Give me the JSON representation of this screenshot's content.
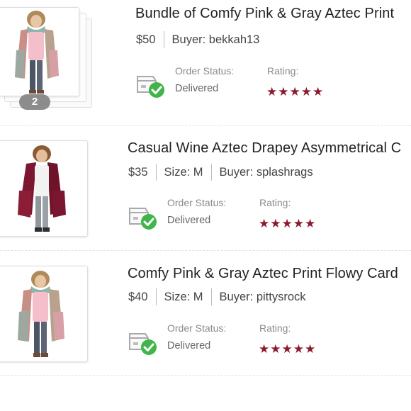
{
  "orders": [
    {
      "title": "Bundle of Comfy Pink & Gray Aztec Print",
      "price": "$50",
      "buyer": "Buyer: bekkah13",
      "bundle_count": "2",
      "status_label": "Order Status:",
      "status_value": "Delivered",
      "rating_label": "Rating:",
      "rating": 5,
      "thumbnail": "pink-gray-aztec-cardigan"
    },
    {
      "title": "Casual Wine Aztec Drapey Asymmetrical C",
      "price": "$35",
      "size": "Size: M",
      "buyer": "Buyer: splashrags",
      "status_label": "Order Status:",
      "status_value": "Delivered",
      "rating_label": "Rating:",
      "rating": 5,
      "thumbnail": "wine-aztec-cardigan"
    },
    {
      "title": "Comfy Pink & Gray Aztec Print Flowy Card",
      "price": "$40",
      "size": "Size: M",
      "buyer": "Buyer: pittysrock",
      "status_label": "Order Status:",
      "status_value": "Delivered",
      "rating_label": "Rating:",
      "rating": 5,
      "thumbnail": "pink-gray-aztec-cardigan"
    }
  ],
  "icons": {
    "delivered": "box-delivered-check-icon",
    "star": "star-icon"
  },
  "colors": {
    "star": "#8b1a2e",
    "check": "#3fb54a",
    "badge": "#8c8c8c"
  }
}
